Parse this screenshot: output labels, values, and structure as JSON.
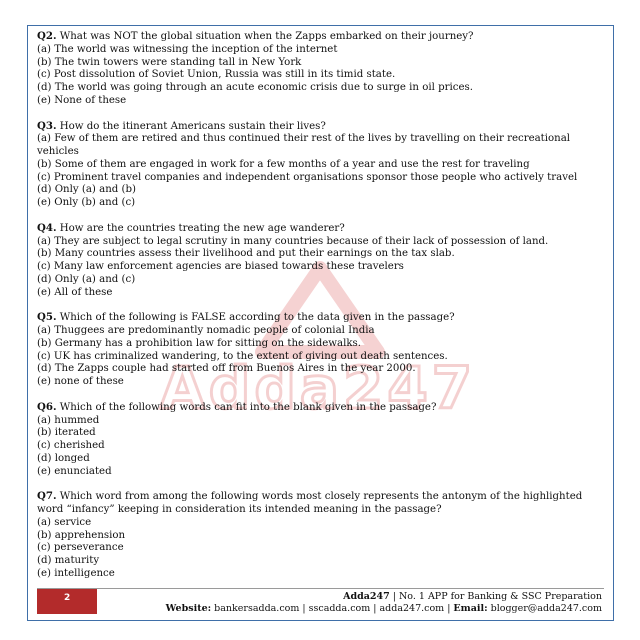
{
  "watermark": {
    "text": "Adda247"
  },
  "questions": [
    {
      "number": "Q2.",
      "text": "What was NOT the global situation when the Zapps embarked on their journey?",
      "options": [
        "(a) The world was witnessing the inception of the internet",
        "(b) The twin towers were standing tall in New York",
        "(c) Post dissolution of Soviet Union, Russia was still in its timid state.",
        "(d) The world was going through an acute economic crisis due to surge in oil prices.",
        "(e) None of these"
      ]
    },
    {
      "number": "Q3.",
      "text": "How do the itinerant Americans sustain their lives?",
      "options": [
        "(a) Few of them are retired and thus continued their rest of the lives by travelling on their recreational vehicles",
        "(b) Some of them are engaged in work for a few months of a year and use the rest for traveling",
        "(c) Prominent travel companies and independent organisations sponsor those people who actively travel",
        "(d) Only (a) and (b)",
        "(e) Only (b) and (c)"
      ]
    },
    {
      "number": "Q4.",
      "text": "How are the countries treating the new age wanderer?",
      "options": [
        "(a) They are subject to legal scrutiny in many countries because of their lack of possession of land.",
        "(b) Many countries assess their livelihood and put their earnings on the tax slab.",
        "(c) Many law enforcement agencies are biased towards these travelers",
        "(d) Only (a) and (c)",
        "(e) All of these"
      ]
    },
    {
      "number": "Q5.",
      "text": "Which of the following is FALSE according to the data given in the passage?",
      "options": [
        "(a) Thuggees are predominantly nomadic people of colonial India",
        "(b) Germany has a prohibition law for sitting on the sidewalks.",
        "(c) UK has criminalized wandering, to the extent of giving out death sentences.",
        "(d) The Zapps couple had started off from Buenos Aires in the year 2000.",
        "(e) none of these"
      ]
    },
    {
      "number": "Q6.",
      "text": "Which of the following words can fit into the blank given in the passage?",
      "options": [
        "(a) hummed",
        "(b) iterated",
        "(c) cherished",
        "(d) longed",
        "(e) enunciated"
      ]
    },
    {
      "number": "Q7.",
      "text": "Which word from among the following words most closely represents the antonym of the highlighted word “infancy” keeping in consideration its intended meaning in the passage?",
      "options": [
        "(a) service",
        "(b) apprehension",
        "(c) perseverance",
        "(d) maturity",
        "(e) intelligence"
      ]
    }
  ],
  "footer": {
    "page_number": "2",
    "brand": "Adda247",
    "tagline": " | No. 1 APP for Banking & SSC Preparation",
    "website_label": "Website:",
    "websites": " bankersadda.com | sscadda.com | adda247.com | ",
    "email_label": "Email:",
    "email": " blogger@adda247.com"
  },
  "colors": {
    "border": "#3f6fa8",
    "accent": "#b32b2b",
    "watermark": "#e8a0a0"
  }
}
